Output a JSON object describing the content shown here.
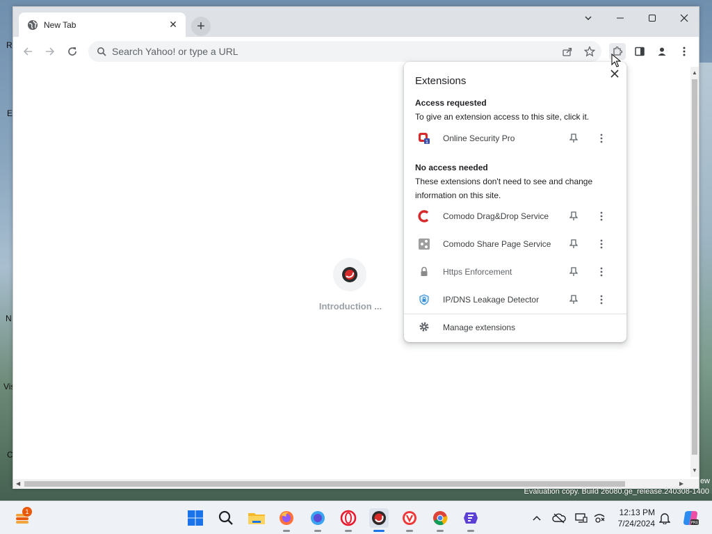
{
  "desktop": {
    "left_fragments": [
      "R",
      "E",
      "N",
      "Vis",
      "C"
    ],
    "right_fragment": "ew",
    "evaluation_text": "Evaluation copy. Build 26080.ge_release.240308-1400"
  },
  "browser": {
    "tab": {
      "title": "New Tab",
      "icon": "globe-icon"
    },
    "omnibox": {
      "placeholder": "Search Yahoo! or type a URL"
    },
    "content": {
      "loading_text": "Introduction ..."
    }
  },
  "extensions_popup": {
    "title": "Extensions",
    "access_requested": {
      "heading": "Access requested",
      "description": "To give an extension access to this site, click it.",
      "items": [
        {
          "name": "Online Security Pro",
          "icon": "online-security-pro-icon"
        }
      ]
    },
    "no_access_needed": {
      "heading": "No access needed",
      "description": "These extensions don't need to see and change information on this site.",
      "items": [
        {
          "name": "Comodo Drag&Drop Service",
          "icon": "comodo-icon"
        },
        {
          "name": "Comodo Share Page Service",
          "icon": "share-page-icon"
        },
        {
          "name": "Https Enforcement",
          "icon": "lock-icon"
        },
        {
          "name": "IP/DNS Leakage Detector",
          "icon": "shield-icon"
        }
      ]
    },
    "manage_label": "Manage extensions"
  },
  "taskbar": {
    "widget_badge": "1",
    "time": "12:13 PM",
    "date": "7/24/2024",
    "colors": {
      "accent": "#1a73e8",
      "comodo_red": "#d62b2b"
    }
  }
}
